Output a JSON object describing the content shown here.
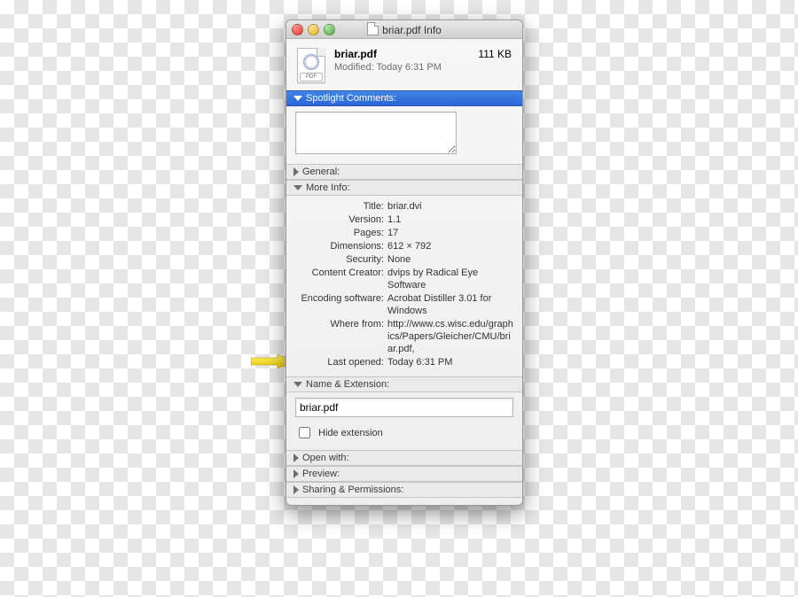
{
  "window": {
    "title": "briar.pdf Info"
  },
  "header": {
    "filename": "briar.pdf",
    "modified": "Modified: Today 6:31 PM",
    "filesize": "111 KB",
    "icon_badge": "PDF"
  },
  "sections": {
    "spotlight": "Spotlight Comments:",
    "general": "General:",
    "more_info": "More Info:",
    "name_ext": "Name & Extension:",
    "open_with": "Open with:",
    "preview": "Preview:",
    "sharing": "Sharing & Permissions:"
  },
  "more_info": {
    "labels": {
      "title": "Title:",
      "version": "Version:",
      "pages": "Pages:",
      "dimensions": "Dimensions:",
      "security": "Security:",
      "content_creator": "Content Creator:",
      "encoding_software": "Encoding software:",
      "where_from": "Where from:",
      "last_opened": "Last opened:"
    },
    "values": {
      "title": "briar.dvi",
      "version": "1.1",
      "pages": "17",
      "dimensions": "612 × 792",
      "security": "None",
      "content_creator": "dvips by Radical Eye Software",
      "encoding_software": "Acrobat Distiller 3.01 for Windows",
      "where_from": "http://www.cs.wisc.edu/graphics/Papers/Gleicher/CMU/briar.pdf,",
      "last_opened": "Today 6:31 PM"
    }
  },
  "name_ext": {
    "value": "briar.pdf",
    "hide_label": "Hide extension",
    "hide_checked": false
  }
}
